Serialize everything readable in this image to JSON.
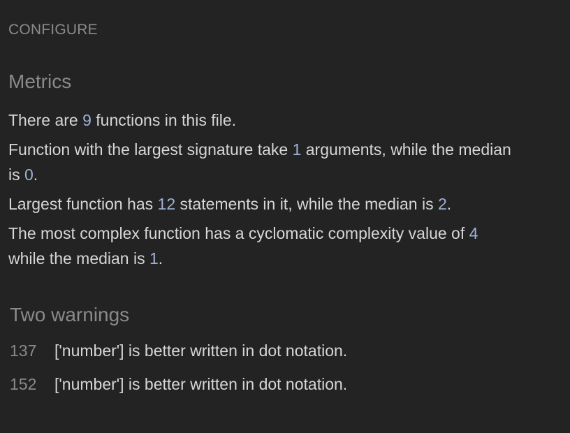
{
  "header": {
    "configure_label": "CONFIGURE"
  },
  "metrics": {
    "title": "Metrics",
    "line1": {
      "pre": "There are ",
      "num": "9",
      "post": " functions in this file."
    },
    "line2": {
      "pre": "Function with the largest signature take ",
      "num1": "1",
      "mid": " arguments, while the median is ",
      "num2": "0",
      "post": "."
    },
    "line3": {
      "pre": "Largest function has ",
      "num1": "12",
      "mid": " statements in it, while the median is ",
      "num2": "2",
      "post": "."
    },
    "line4": {
      "pre": "The most complex function has a cyclomatic complexity value of ",
      "num1": "4",
      "mid": " while the median is ",
      "num2": "1",
      "post": "."
    }
  },
  "warnings": {
    "title": "Two warnings",
    "items": [
      {
        "line": "137",
        "message": "['number'] is better written in dot notation."
      },
      {
        "line": "152",
        "message": "['number'] is better written in dot notation."
      }
    ]
  },
  "colors": {
    "background": "#232323",
    "muted": "#8a8a8a",
    "text": "#d6d6d6",
    "number_accent": "#9fb0d6"
  }
}
